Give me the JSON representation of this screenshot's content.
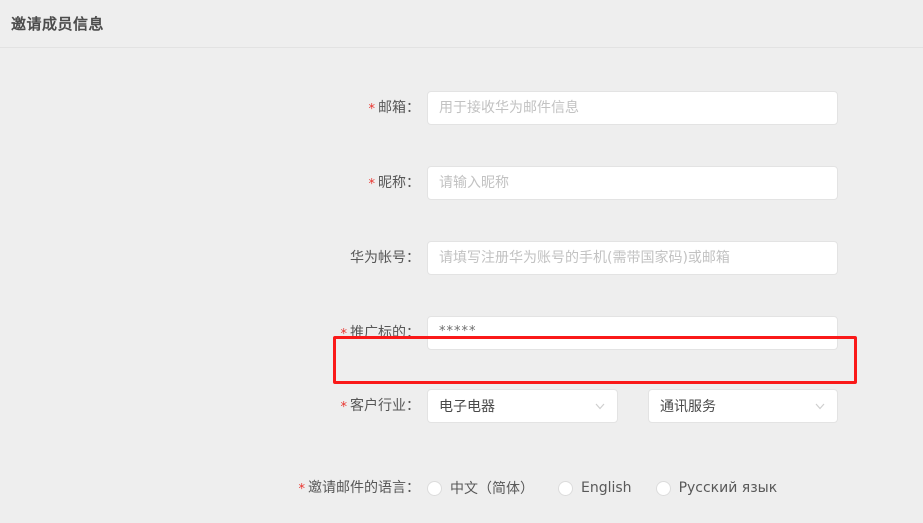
{
  "header": {
    "title": "邀请成员信息"
  },
  "form": {
    "fields": [
      {
        "label": "邮箱：",
        "required": true,
        "placeholder": "用于接收华为邮件信息",
        "value": ""
      },
      {
        "label": "昵称：",
        "required": true,
        "placeholder": "请输入昵称",
        "value": ""
      },
      {
        "label": "华为帐号：",
        "required": false,
        "placeholder": "请填写注册华为账号的手机(需带国家码)或邮箱",
        "value": ""
      },
      {
        "label": "推广标的：",
        "required": true,
        "placeholder": "",
        "value": "*****"
      }
    ],
    "industry": {
      "label": "客户行业：",
      "required": true,
      "primary_value": "电子电器",
      "secondary_value": "通讯服务",
      "chevron_icon": "chevron-down-icon",
      "highlight_color": "#fa1919"
    },
    "language": {
      "label": "邀请邮件的语言：",
      "required": true,
      "options": [
        {
          "label": "中文（简体）",
          "selected": false
        },
        {
          "label": "English",
          "selected": false
        },
        {
          "label": "Русский язык",
          "selected": false
        }
      ]
    },
    "required_marker": "*",
    "required_color": "#e8322c"
  }
}
